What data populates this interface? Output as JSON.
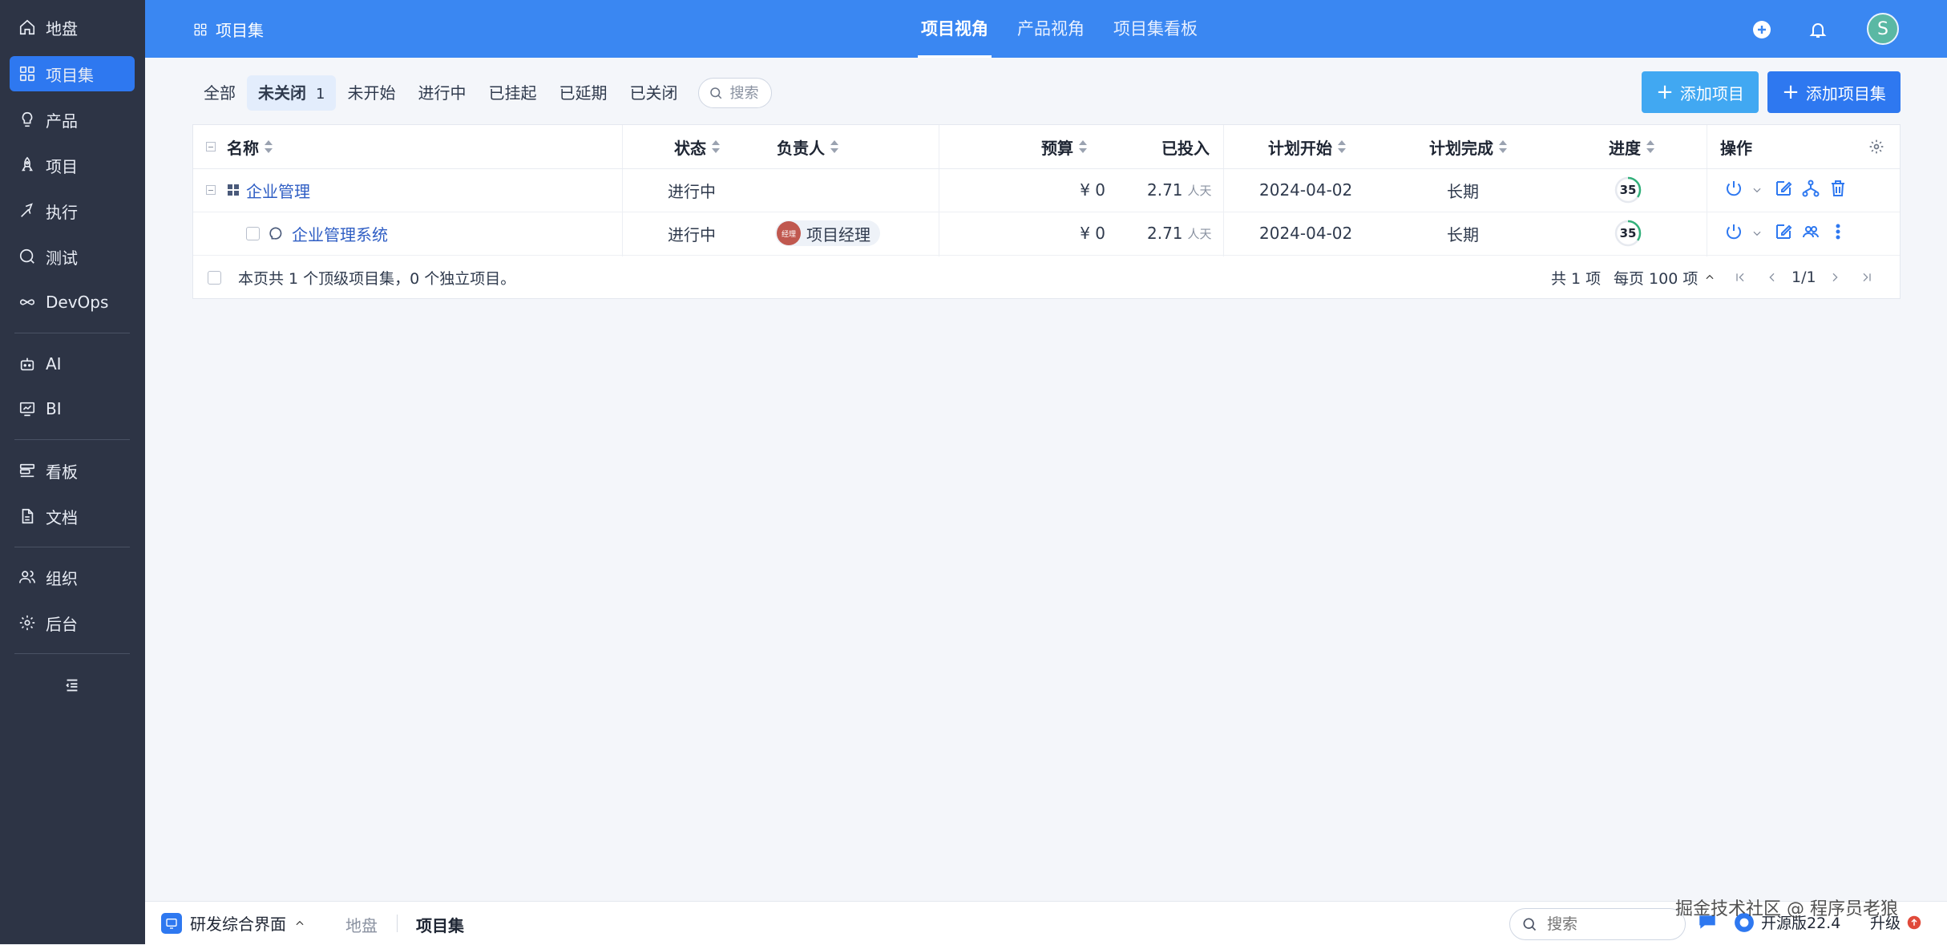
{
  "sidebar": {
    "items": [
      {
        "label": "地盘",
        "icon": "home-icon"
      },
      {
        "label": "项目集",
        "icon": "grid-icon",
        "active": true
      },
      {
        "label": "产品",
        "icon": "lightbulb-icon"
      },
      {
        "label": "项目",
        "icon": "rocket-icon"
      },
      {
        "label": "执行",
        "icon": "sprint-icon"
      },
      {
        "label": "测试",
        "icon": "search-circle-icon"
      },
      {
        "label": "DevOps",
        "icon": "infinity-icon"
      },
      {
        "label": "AI",
        "icon": "robot-icon"
      },
      {
        "label": "BI",
        "icon": "chart-board-icon"
      },
      {
        "label": "看板",
        "icon": "kanban-icon"
      },
      {
        "label": "文档",
        "icon": "document-icon"
      },
      {
        "label": "组织",
        "icon": "users-icon"
      },
      {
        "label": "后台",
        "icon": "gear-icon"
      }
    ]
  },
  "topbar": {
    "section_title": "项目集",
    "tabs": [
      {
        "label": "项目视角",
        "active": true
      },
      {
        "label": "产品视角"
      },
      {
        "label": "项目集看板"
      }
    ],
    "avatar_letter": "S"
  },
  "filters": {
    "tabs": [
      {
        "label": "全部"
      },
      {
        "label": "未关闭",
        "count": "1",
        "active": true
      },
      {
        "label": "未开始"
      },
      {
        "label": "进行中"
      },
      {
        "label": "已挂起"
      },
      {
        "label": "已延期"
      },
      {
        "label": "已关闭"
      }
    ],
    "search_placeholder": "搜索"
  },
  "buttons": {
    "add_project": "添加项目",
    "add_program": "添加项目集"
  },
  "table": {
    "headers": {
      "name": "名称",
      "status": "状态",
      "owner": "负责人",
      "budget": "预算",
      "invested": "已投入",
      "plan_start": "计划开始",
      "plan_end": "计划完成",
      "progress": "进度",
      "actions": "操作"
    },
    "rows": [
      {
        "name": "企业管理",
        "status": "进行中",
        "owner": "",
        "budget": "¥ 0",
        "invested": "2.71",
        "invested_unit": "人天",
        "plan_start": "2024-04-02",
        "plan_end": "长期",
        "progress": "35",
        "progress_pct": 35
      },
      {
        "name": "企业管理系统",
        "status": "进行中",
        "owner": "项目经理",
        "owner_avatar": "经理",
        "budget": "¥ 0",
        "invested": "2.71",
        "invested_unit": "人天",
        "plan_start": "2024-04-02",
        "plan_end": "长期",
        "progress": "35",
        "progress_pct": 35
      }
    ],
    "footer": {
      "summary": "本页共 1 个顶级项目集，0 个独立项目。",
      "total": "共 1 项",
      "per_page": "每页 100 项",
      "page": "1/1"
    }
  },
  "bottombar": {
    "app_name": "研发综合界面",
    "crumbs": [
      "地盘",
      "项目集"
    ],
    "search_placeholder": "搜索",
    "version": "开源版22.4",
    "upgrade": "升级"
  },
  "watermark": "掘金技术社区 @ 程序员老狼",
  "colors": {
    "sidebar_bg": "#2d3445",
    "topbar_bg": "#3a87f2",
    "primary": "#2e78f0",
    "status_in_progress": "#e06a3a",
    "progress_ring": "#32b07a"
  }
}
